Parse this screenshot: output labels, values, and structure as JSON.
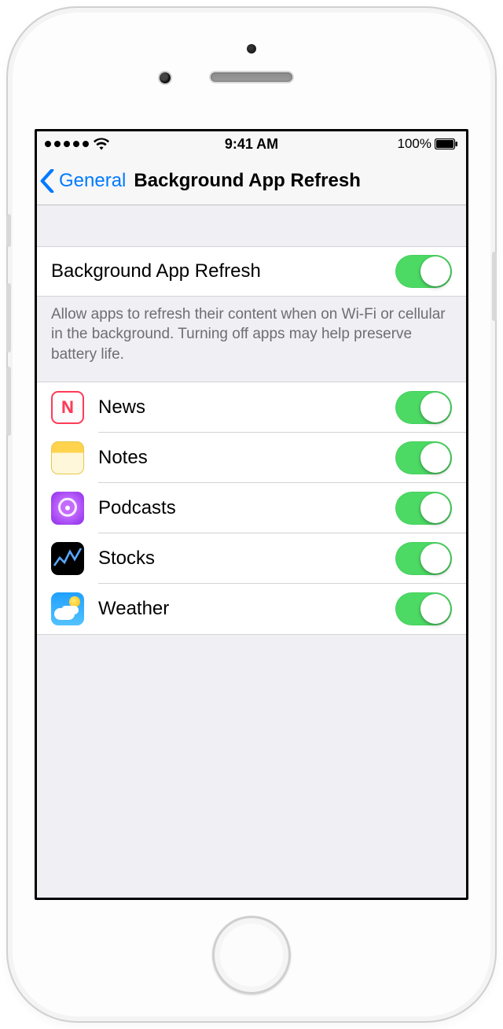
{
  "status": {
    "time": "9:41 AM",
    "battery_pct": "100%"
  },
  "nav": {
    "back_label": "General",
    "title": "Background App Refresh"
  },
  "master": {
    "label": "Background App Refresh",
    "enabled": true
  },
  "footer": "Allow apps to refresh their content when on Wi-Fi or cellular in the background. Turning off apps may help preserve battery life.",
  "apps": [
    {
      "name": "News",
      "icon": "news-icon",
      "enabled": true
    },
    {
      "name": "Notes",
      "icon": "notes-icon",
      "enabled": true
    },
    {
      "name": "Podcasts",
      "icon": "podcasts-icon",
      "enabled": true
    },
    {
      "name": "Stocks",
      "icon": "stocks-icon",
      "enabled": true
    },
    {
      "name": "Weather",
      "icon": "weather-icon",
      "enabled": true
    }
  ]
}
